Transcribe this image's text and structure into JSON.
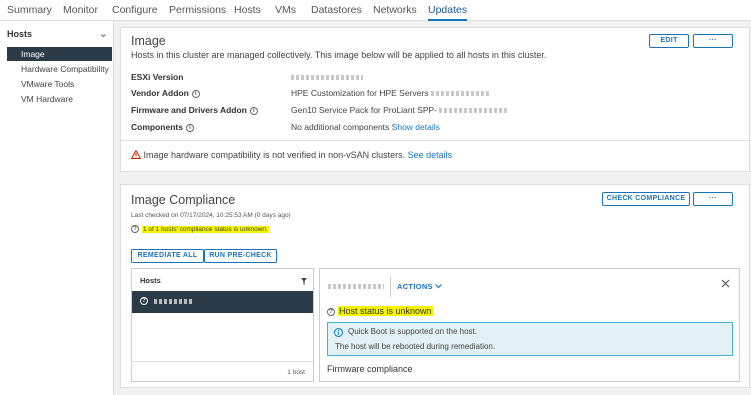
{
  "tabs": [
    "Summary",
    "Monitor",
    "Configure",
    "Permissions",
    "Hosts",
    "VMs",
    "Datastores",
    "Networks",
    "Updates"
  ],
  "sidebar": {
    "heading": "Hosts",
    "items": [
      "Image",
      "Hardware Compatibility",
      "VMware Tools",
      "VM Hardware"
    ]
  },
  "image_card": {
    "title": "Image",
    "description": "Hosts in this cluster are managed collectively. This image below will be applied to all hosts in this cluster.",
    "edit_label": "EDIT",
    "more_label": "···",
    "fields": {
      "esxi_label": "ESXi Version",
      "vendor_label": "Vendor Addon",
      "vendor_value": "HPE Customization for HPE Servers",
      "firmware_label": "Firmware and Drivers Addon",
      "firmware_value": "Gen10 Service Pack for ProLiant SPP-",
      "components_label": "Components",
      "components_value": "No additional components",
      "show_details": "Show details"
    },
    "warning_text": "Image hardware compatibility is not verified in non-vSAN clusters.",
    "see_details": "See details"
  },
  "compliance_card": {
    "title": "Image Compliance",
    "last_checked": "Last checked on 07/17/2024, 10:25:53 AM (0 days ago)",
    "status_summary": "1 of 1 hosts' compliance status is unknown.",
    "check_label": "CHECK COMPLIANCE",
    "more_label": "···",
    "remediate_label": "REMEDIATE ALL",
    "precheck_label": "RUN PRE-CHECK",
    "hosts_header": "Hosts",
    "hosts_footer": "1 host",
    "actions_label": "ACTIONS",
    "host_status": "Host status is unknown",
    "info_line1": "Quick Boot is supported on the host.",
    "info_line2": "The host will be rebooted during remediation.",
    "firmware_compliance": "Firmware compliance"
  },
  "colors": {
    "accent": "#1c74b8",
    "selected_row": "#2a3a47",
    "highlight": "#f5f500",
    "warning": "#c92100",
    "info_bg": "#e1f1f6"
  }
}
